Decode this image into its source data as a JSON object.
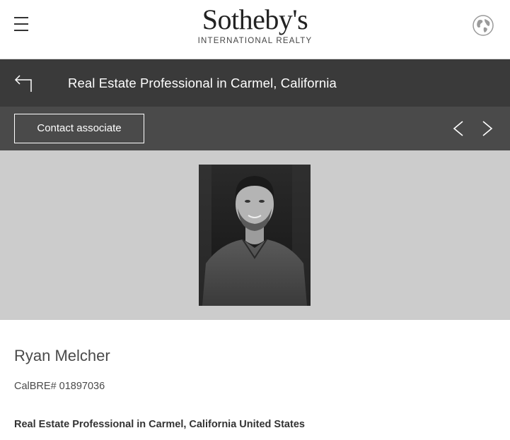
{
  "header": {
    "logo_main": "Sotheby's",
    "logo_sub": "INTERNATIONAL REALTY",
    "menu_icon": "hamburger-menu-icon",
    "globe_icon": "globe-icon"
  },
  "titlebar": {
    "back_icon": "back-arrow-icon",
    "title": "Real Estate Professional in Carmel, California"
  },
  "actionbar": {
    "contact_label": "Contact associate",
    "prev_icon": "chevron-left-icon",
    "next_icon": "chevron-right-icon"
  },
  "agent": {
    "name": "Ryan Melcher",
    "license": "CalBRE# 01897036",
    "headline": "Real Estate Professional in Carmel, California United States"
  },
  "colors": {
    "header_bg": "#ffffff",
    "titlebar_bg": "#3a3a3a",
    "actionbar_bg": "#4a4a4a",
    "photo_bg": "#cccccc"
  }
}
